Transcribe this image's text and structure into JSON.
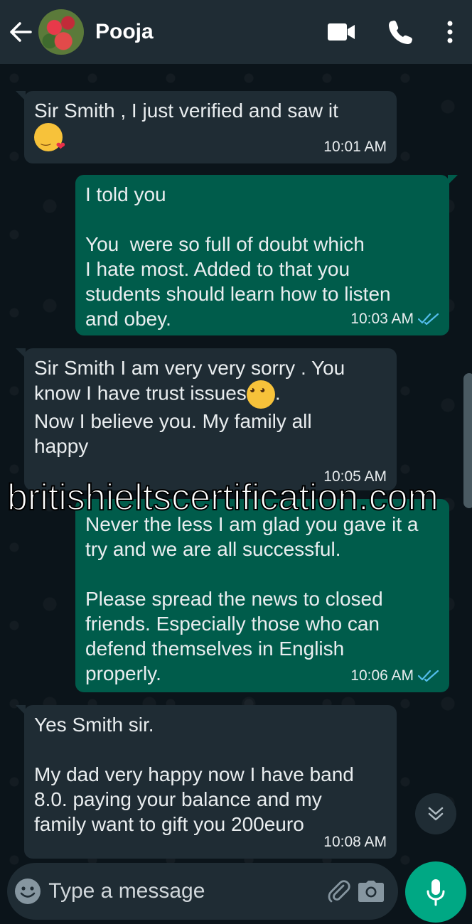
{
  "header": {
    "contact_name": "Pooja",
    "icons": [
      "back-arrow-icon",
      "video-call-icon",
      "voice-call-icon",
      "more-options-icon"
    ]
  },
  "messages": [
    {
      "direction": "incoming",
      "text": "Sir Smith , I just verified and saw it",
      "emoji": "face-blowing-kiss",
      "time": "10:01 AM"
    },
    {
      "direction": "outgoing",
      "text": "I told you\n\nYou  were so full of doubt which\nI hate most. Added to that you\nstudents should learn how to listen\nand obey.",
      "time": "10:03 AM",
      "status": "read"
    },
    {
      "direction": "incoming",
      "text_line1": "Sir Smith I am very very sorry . You\nknow I have trust issues",
      "emoji": "pleading-face",
      "text_after_emoji": ".",
      "text_line2": "\nNow I believe you. My family all\nhappy",
      "time": "10:05 AM"
    },
    {
      "direction": "outgoing",
      "text": "Never the less I am glad you gave it a\ntry and we are all successful.\n\nPlease spread the news to closed\nfriends. Especially those who can\ndefend themselves in English\nproperly.",
      "time": "10:06 AM",
      "status": "read"
    },
    {
      "direction": "incoming",
      "text": "Yes Smith sir.\n\nMy dad very happy now I have band\n8.0. paying your balance and my\nfamily want to gift you 200euro",
      "time": "10:08 AM"
    }
  ],
  "watermark": "britishieltscertification.com",
  "composer": {
    "placeholder": "Type a message",
    "value": ""
  },
  "colors": {
    "background": "#0b141a",
    "header": "#1f2c34",
    "incoming_bubble": "#1f2c34",
    "outgoing_bubble": "#005c4b",
    "accent": "#00a884",
    "read_ticks": "#53bdeb"
  }
}
